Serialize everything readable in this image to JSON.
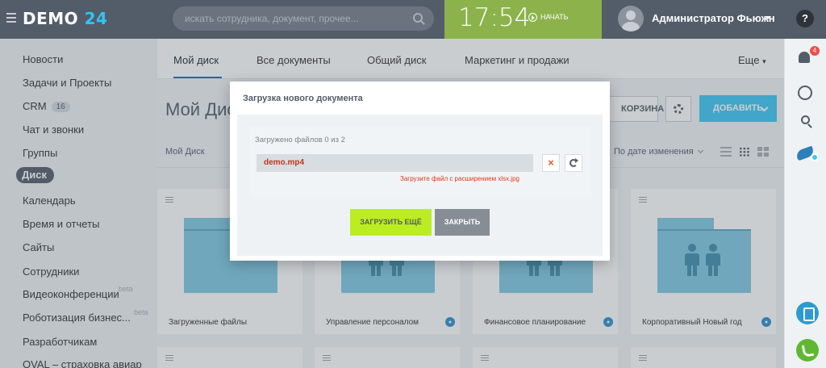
{
  "header": {
    "logo_text": "DEMO",
    "logo_number": "24",
    "search_placeholder": "искать сотрудника, документ, прочее...",
    "clock_time": "17:54",
    "clock_start_label": "НАЧАТЬ",
    "user_name": "Администратор Фьюжн",
    "help_label": "?"
  },
  "sidebar": {
    "items": [
      {
        "label": "Новости"
      },
      {
        "label": "Задачи и Проекты"
      },
      {
        "label": "CRM",
        "badge": "16"
      },
      {
        "label": "Чат и звонки"
      },
      {
        "label": "Группы"
      },
      {
        "label": "Диск",
        "active": true
      },
      {
        "label": "Календарь"
      },
      {
        "label": "Время и отчеты"
      },
      {
        "label": "Сайты"
      },
      {
        "label": "Сотрудники"
      },
      {
        "label": "Видеоконференции",
        "suffix": "beta"
      },
      {
        "label": "Роботизация бизнес...",
        "suffix": "beta"
      },
      {
        "label": "Разработчикам"
      },
      {
        "label": "OVAL – страховка авиар"
      }
    ]
  },
  "tabs": [
    {
      "label": "Мой диск",
      "active": true
    },
    {
      "label": "Все документы"
    },
    {
      "label": "Общий диск"
    },
    {
      "label": "Маркетинг и продажи"
    }
  ],
  "tabs_more": "Еще",
  "page": {
    "title": "Мой Диск",
    "trash_label": "КОРЗИНА",
    "add_label": "ДОБАВИТЬ",
    "breadcrumb": "Мой Диск",
    "sort_label": "По дате изменения"
  },
  "cards": [
    {
      "title": "Загруженные файлы",
      "people": false,
      "shared": false
    },
    {
      "title": "Управление персоналом",
      "people": true,
      "shared": true
    },
    {
      "title": "Финансовое планирование",
      "people": true,
      "shared": true
    },
    {
      "title": "Корпоративный Новый год",
      "people": true,
      "shared": true
    }
  ],
  "rightbar": {
    "notification_count": "4"
  },
  "modal": {
    "title": "Загрузка нового документа",
    "upload_status": "Загружено файлов 0 из 2",
    "file_name": "demo.mp4",
    "error_text": "Загрузите файл с расширением xlsx.jpg",
    "remove_label": "×",
    "upload_more_label": "ЗАГРУЗИТЬ ЕЩЁ",
    "close_label": "ЗАКРЫТЬ"
  },
  "colors": {
    "header_bg": "#535c69",
    "clock_bg": "#8cb34b",
    "accent_blue": "#3bc8f5",
    "upload_more_bg": "#bbed21",
    "error_red": "#e0341a"
  }
}
